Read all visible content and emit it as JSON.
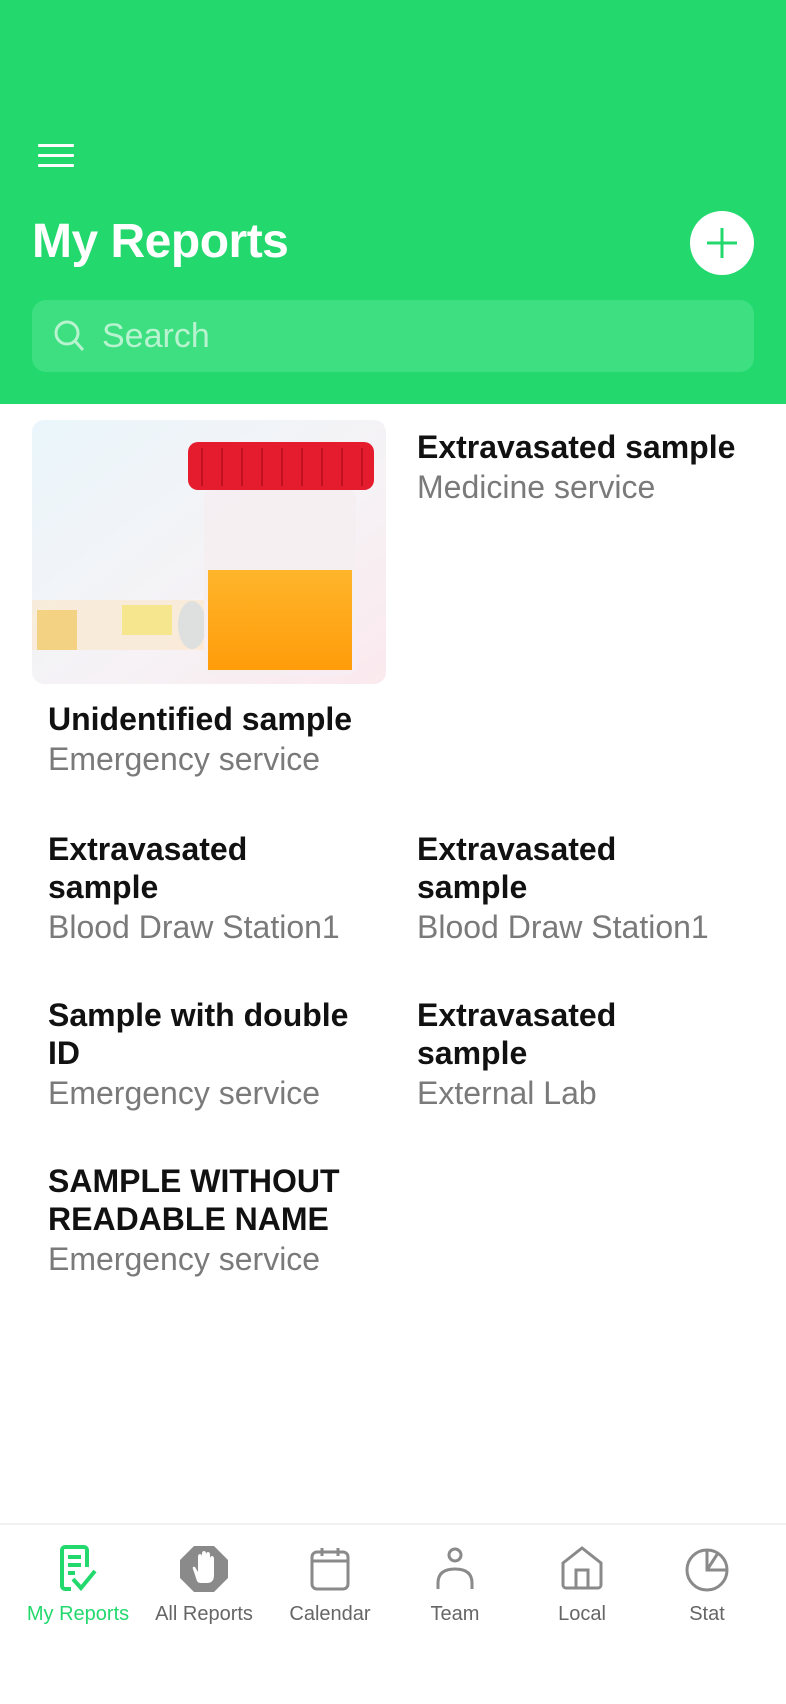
{
  "header": {
    "title": "My Reports",
    "search_placeholder": "Search",
    "search_value": ""
  },
  "colors": {
    "brand": "#23d96e",
    "search_bg": "#3ddf80",
    "inactive": "#8a8a8a"
  },
  "reports": [
    {
      "name": "Extravasated sample",
      "service": "Medicine service",
      "has_image": true
    },
    {
      "name": "Unidentified sample",
      "service": "Emergency service"
    },
    {
      "name": "Extravasated sample",
      "service": "Blood Draw Station1"
    },
    {
      "name": "Extravasated sample",
      "service": "Blood Draw Station1"
    },
    {
      "name": "Sample with double ID",
      "service": "Emergency service"
    },
    {
      "name": "Extravasated sample",
      "service": "External Lab"
    },
    {
      "name": "SAMPLE WITHOUT READABLE NAME",
      "service": "Emergency service"
    }
  ],
  "nav": {
    "items": [
      {
        "label": "My Reports",
        "icon": "report-check-icon",
        "active": true
      },
      {
        "label": "All Reports",
        "icon": "stop-hand-icon"
      },
      {
        "label": "Calendar",
        "icon": "calendar-icon"
      },
      {
        "label": "Team",
        "icon": "person-icon"
      },
      {
        "label": "Local",
        "icon": "home-icon"
      },
      {
        "label": "Stat",
        "icon": "pie-chart-icon"
      }
    ]
  }
}
